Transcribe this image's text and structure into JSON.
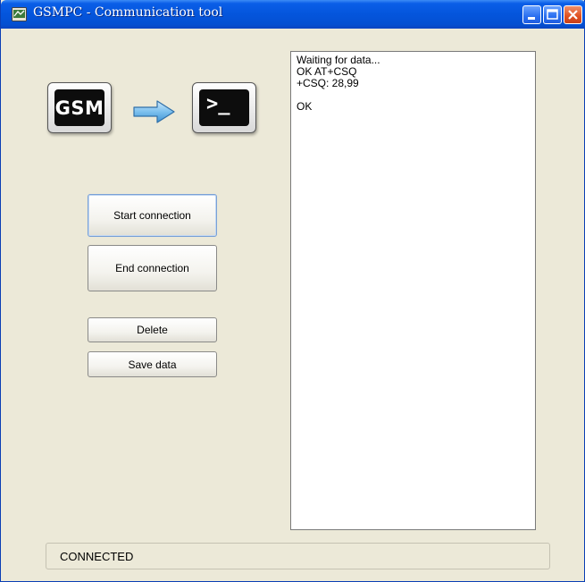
{
  "window": {
    "title": "GSMPC - Communication tool"
  },
  "logos": {
    "gsm_text": "GSM",
    "terminal_text": ">_",
    "arrow_icon": "right-arrow-icon",
    "accent_color": "#6fb6ea"
  },
  "buttons": {
    "start_connection": "Start connection",
    "end_connection": "End connection",
    "delete": "Delete",
    "save_data": "Save data"
  },
  "output": {
    "lines": [
      "Waiting for data...",
      "OK AT+CSQ",
      "+CSQ: 28,99",
      "",
      "OK"
    ]
  },
  "status": {
    "text": "CONNECTED"
  }
}
